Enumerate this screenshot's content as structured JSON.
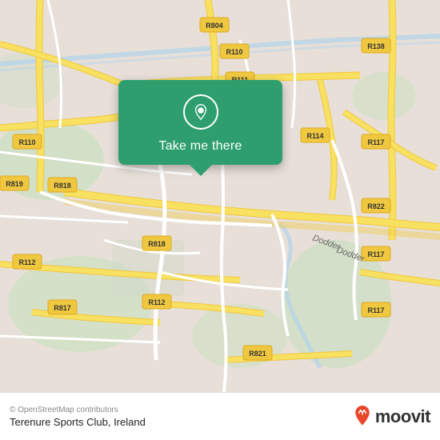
{
  "map": {
    "popup": {
      "label": "Take me there",
      "icon": "location-pin"
    },
    "colors": {
      "popup_bg": "#2e9e6e",
      "road_primary": "#f5d96b",
      "road_secondary": "#ffffff",
      "road_ring": "#f0c040",
      "map_bg": "#e8e0d8",
      "green_area": "#c8dfc0",
      "water": "#b0d0e8"
    }
  },
  "bottom_bar": {
    "copyright": "© OpenStreetMap contributors",
    "location_name": "Terenure Sports Club, Ireland",
    "logo_text": "moovit"
  }
}
